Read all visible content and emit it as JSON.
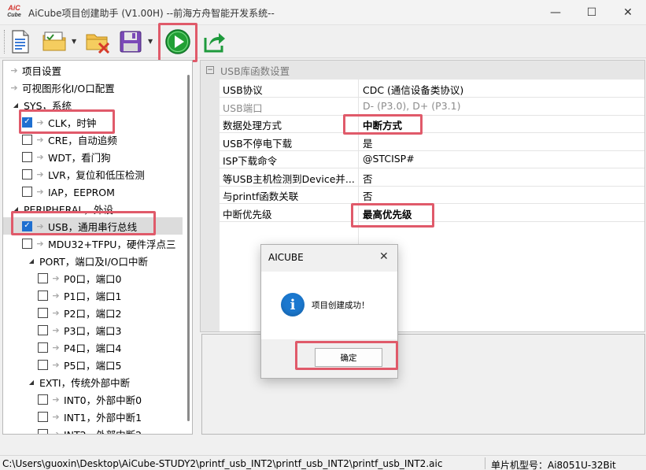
{
  "window": {
    "logo_top": "AiC",
    "logo_bottom": "Cube",
    "title": "AiCube项目创建助手 (V1.00H) --前海方舟智能开发系统--",
    "minimize": "—",
    "maximize": "☐",
    "close": "✕"
  },
  "toolbar": {
    "buttons": [
      "new-document",
      "open-project",
      "close-project",
      "save-project",
      "run-create-project",
      "export-project"
    ]
  },
  "tree": {
    "items": [
      {
        "label": "项目设置",
        "type": "arrow"
      },
      {
        "label": "可视图形化I/O口配置",
        "type": "arrow"
      },
      {
        "label": "SYS，系统",
        "type": "group"
      },
      {
        "label": "CLK，时钟",
        "type": "check",
        "checked": true
      },
      {
        "label": "CRE，自动追频",
        "type": "check",
        "checked": false
      },
      {
        "label": "WDT，看门狗",
        "type": "check",
        "checked": false
      },
      {
        "label": "LVR，复位和低压检测",
        "type": "check",
        "checked": false
      },
      {
        "label": "IAP，EEPROM",
        "type": "check",
        "checked": false
      },
      {
        "label": "PERIPHERAL，外设",
        "type": "group"
      },
      {
        "label": "USB，通用串行总线",
        "type": "check",
        "checked": true,
        "selected": true
      },
      {
        "label": "MDU32+TFPU，硬件浮点三",
        "type": "check",
        "checked": false
      },
      {
        "label": "PORT，端口及I/O口中断",
        "type": "group"
      },
      {
        "label": "P0口，端口0",
        "type": "check",
        "checked": false
      },
      {
        "label": "P1口，端口1",
        "type": "check",
        "checked": false
      },
      {
        "label": "P2口，端口2",
        "type": "check",
        "checked": false
      },
      {
        "label": "P3口，端口3",
        "type": "check",
        "checked": false
      },
      {
        "label": "P4口，端口4",
        "type": "check",
        "checked": false
      },
      {
        "label": "P5口，端口5",
        "type": "check",
        "checked": false
      },
      {
        "label": "EXTI，传统外部中断",
        "type": "group"
      },
      {
        "label": "INT0，外部中断0",
        "type": "check",
        "checked": false
      },
      {
        "label": "INT1，外部中断1",
        "type": "check",
        "checked": false
      },
      {
        "label": "INT2，外部中断2",
        "type": "check",
        "checked": false
      }
    ]
  },
  "props": {
    "section": "USB库函数设置",
    "rows": [
      {
        "key": "USB协议",
        "value": "CDC (通信设备类协议)"
      },
      {
        "key": "USB端口",
        "value": "D- (P3.0), D+ (P3.1)"
      },
      {
        "key": "数据处理方式",
        "value": "中断方式"
      },
      {
        "key": "USB不停电下载",
        "value": "是"
      },
      {
        "key": "ISP下载命令",
        "value": "@STCISP#"
      },
      {
        "key": "等USB主机检测到Device并...",
        "value": "否"
      },
      {
        "key": "与printf函数关联",
        "value": "否"
      },
      {
        "key": "中断优先级",
        "value": "最高优先级"
      }
    ]
  },
  "status": {
    "path": "C:\\Users\\guoxin\\Desktop\\AiCube-STUDY2\\printf_usb_INT2\\printf_usb_INT2\\printf_usb_INT2.aic",
    "chip": "单片机型号：Ai8051U-32Bit"
  },
  "dialog": {
    "title": "AICUBE",
    "close": "✕",
    "icon": "i",
    "message": "项目创建成功！",
    "ok": "确定"
  },
  "colors": {
    "highlight": "#e05a6a",
    "checkbox": "#1f6fd0",
    "run_button": "#22a035",
    "info_icon": "#1b78cf"
  }
}
